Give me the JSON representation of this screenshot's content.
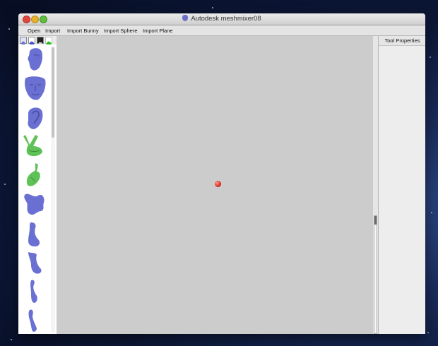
{
  "window": {
    "title": "Autodesk meshmixer08"
  },
  "menu": {
    "items": [
      "Open",
      "Import",
      "Import Bunny",
      "Import Sphere",
      "Import Plane"
    ]
  },
  "toolbox": {
    "buttons": [
      "head-icon",
      "sphere-icon",
      "square-icon",
      "pentagon-icon"
    ]
  },
  "library": {
    "items": [
      {
        "icon": "head-mesh-icon",
        "color": "#6a6fd2"
      },
      {
        "icon": "face-mesh-icon",
        "color": "#6a6fd2"
      },
      {
        "icon": "ear-mesh-icon",
        "color": "#6a6fd2"
      },
      {
        "icon": "hand-peace-mesh-icon",
        "color": "#5fc256"
      },
      {
        "icon": "hand-fist-mesh-icon",
        "color": "#5fc256"
      },
      {
        "icon": "body-part-mesh-icon",
        "color": "#6a6fd2"
      },
      {
        "icon": "foot-mesh-icon",
        "color": "#6a6fd2"
      },
      {
        "icon": "leg-mesh-icon",
        "color": "#6a6fd2"
      },
      {
        "icon": "limb-mesh-icon",
        "color": "#6a6fd2"
      },
      {
        "icon": "arm-mesh-icon",
        "color": "#6a6fd2"
      }
    ]
  },
  "properties": {
    "title": "Tool Properties"
  },
  "colors": {
    "viewport": "#cccccc",
    "mesh": "#6a6fd2",
    "mesh_green": "#5fc256",
    "pivot": "#d62d1e"
  }
}
